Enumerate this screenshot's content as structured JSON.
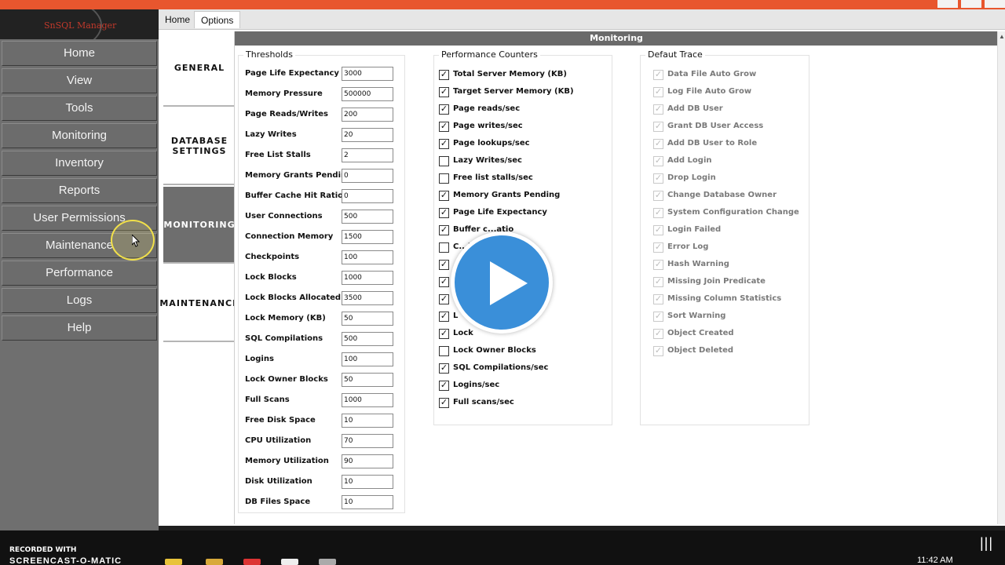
{
  "app": {
    "logo_text": "SnSQL Manager"
  },
  "nav": {
    "items": [
      "Home",
      "View",
      "Tools",
      "Monitoring",
      "Inventory",
      "Reports",
      "User Permissions",
      "Maintenance",
      "Performance",
      "Logs",
      "Help"
    ]
  },
  "ribbon": {
    "tabs": [
      "Home",
      "Options"
    ],
    "active": "Options"
  },
  "side_tabs": {
    "items": [
      "GENERAL",
      "DATABASE SETTINGS",
      "MONITORING",
      "MAINTENANCE"
    ],
    "active": "MONITORING"
  },
  "panel": {
    "title": "Monitoring"
  },
  "thresholds": {
    "title": "Thresholds",
    "rows": [
      {
        "label": "Page Life Expectancy",
        "value": "3000"
      },
      {
        "label": "Memory Pressure",
        "value": "500000"
      },
      {
        "label": "Page Reads/Writes",
        "value": "200"
      },
      {
        "label": "Lazy Writes",
        "value": "20"
      },
      {
        "label": "Free List Stalls",
        "value": "2"
      },
      {
        "label": "Memory Grants Pending",
        "value": "0"
      },
      {
        "label": "Buffer Cache Hit Ratio",
        "value": "0"
      },
      {
        "label": "User Connections",
        "value": "500"
      },
      {
        "label": "Connection Memory",
        "value": "1500"
      },
      {
        "label": "Checkpoints",
        "value": "100"
      },
      {
        "label": "Lock Blocks",
        "value": "1000"
      },
      {
        "label": "Lock Blocks Allocated",
        "value": "3500"
      },
      {
        "label": "Lock Memory (KB)",
        "value": "50"
      },
      {
        "label": "SQL Compilations",
        "value": "500"
      },
      {
        "label": "Logins",
        "value": "100"
      },
      {
        "label": "Lock Owner Blocks",
        "value": "50"
      },
      {
        "label": "Full Scans",
        "value": "1000"
      },
      {
        "label": "Free Disk Space",
        "value": "10"
      },
      {
        "label": "CPU Utilization",
        "value": "70"
      },
      {
        "label": "Memory Utilization",
        "value": "90"
      },
      {
        "label": "Disk Utilization",
        "value": "10"
      },
      {
        "label": "DB Files Space",
        "value": "10"
      }
    ]
  },
  "perf_counters": {
    "title": "Performance Counters",
    "rows": [
      {
        "label": "Total Server Memory (KB)",
        "checked": true
      },
      {
        "label": "Target Server Memory (KB)",
        "checked": true
      },
      {
        "label": "Page reads/sec",
        "checked": true
      },
      {
        "label": "Page writes/sec",
        "checked": true
      },
      {
        "label": "Page lookups/sec",
        "checked": true
      },
      {
        "label": "Lazy Writes/sec",
        "checked": false
      },
      {
        "label": "Free list stalls/sec",
        "checked": false
      },
      {
        "label": "Memory Grants Pending",
        "checked": true
      },
      {
        "label": "Page Life Expectancy",
        "checked": true
      },
      {
        "label": "Buffer c...atio",
        "checked": true
      },
      {
        "label": "C...)",
        "checked": false
      },
      {
        "label": "",
        "checked": true
      },
      {
        "label": "",
        "checked": true
      },
      {
        "label": "",
        "checked": true
      },
      {
        "label": "L",
        "checked": true
      },
      {
        "label": "Lock",
        "checked": true
      },
      {
        "label": "Lock Owner Blocks",
        "checked": false
      },
      {
        "label": "SQL Compilations/sec",
        "checked": true
      },
      {
        "label": "Logins/sec",
        "checked": true
      },
      {
        "label": "Full scans/sec",
        "checked": true
      }
    ]
  },
  "default_trace": {
    "title": "Defaut Trace",
    "rows": [
      "Data File Auto Grow",
      "Log File Auto Grow",
      "Add DB User",
      "Grant DB User Access",
      "Add DB User to Role",
      "Add Login",
      "Drop Login",
      "Change Database Owner",
      "System Configuration Change",
      "Login Failed",
      "Error Log",
      "Hash Warning",
      "Missing Join Predicate",
      "Missing Column Statistics",
      "Sort Warning",
      "Object Created",
      "Object Deleted"
    ]
  },
  "taskbar": {
    "recorded_with": "RECORDED WITH",
    "brand": "SCREENCAST-O-MATIC",
    "clock": "11:42 AM"
  },
  "colors": {
    "accent_titlebar": "#e8562e",
    "nav_bg": "#6c6c6c",
    "play_button": "#3a8fd9"
  }
}
